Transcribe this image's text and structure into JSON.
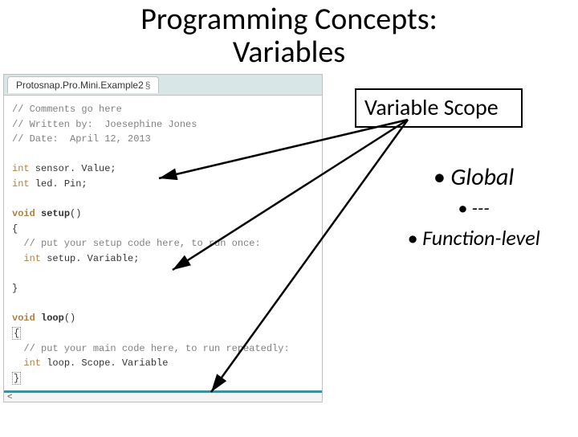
{
  "title_line1": "Programming Concepts:",
  "title_line2": "Variables",
  "tab_name": "Protosnap.Pro.Mini.Example2",
  "tab_section": "§",
  "code": {
    "c1": "// Comments go here",
    "c2": "// Written by:  Joesephine Jones",
    "c3": "// Date:  April 12, 2013",
    "decl1_type": "int",
    "decl1_name": " sensor. Value;",
    "decl2_type": "int",
    "decl2_name": " led. Pin;",
    "setup_kw": "void",
    "setup_fn": " setup",
    "setup_sig": "()",
    "brace_open": "{",
    "setup_comment": "  // put your setup code here, to run once:",
    "setup_var_type": "int",
    "setup_var_name": " setup. Variable;",
    "brace_close": "}",
    "loop_kw": "void",
    "loop_fn": " loop",
    "loop_sig": "()",
    "loop_comment": "  // put your main code here, to run repeatedly:",
    "loop_var_type": "int",
    "loop_var_name": " loop. Scope. Variable",
    "brace_close2": "}"
  },
  "footer_glyph": "<",
  "scope_heading": "Variable Scope",
  "bullet1": "• Global",
  "bullet2": "• ---",
  "bullet3": "• Function-level"
}
